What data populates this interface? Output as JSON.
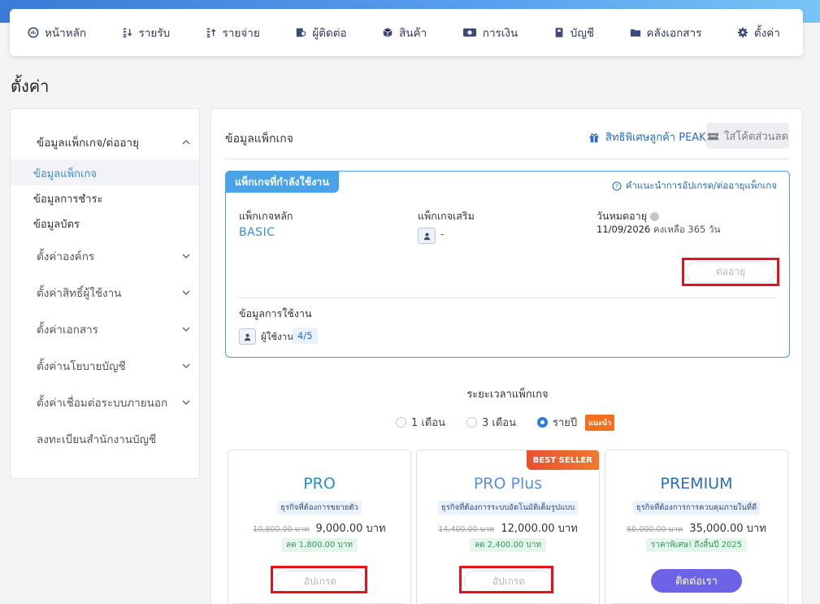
{
  "nav": {
    "items": [
      {
        "label": "หน้าหลัก",
        "icon": "dashboard-icon"
      },
      {
        "label": "รายรับ",
        "icon": "income-icon"
      },
      {
        "label": "รายจ่าย",
        "icon": "expense-icon"
      },
      {
        "label": "ผู้ติดต่อ",
        "icon": "contacts-icon"
      },
      {
        "label": "สินค้า",
        "icon": "box-icon"
      },
      {
        "label": "การเงิน",
        "icon": "money-icon"
      },
      {
        "label": "บัญชี",
        "icon": "ledger-icon"
      },
      {
        "label": "คลังเอกสาร",
        "icon": "folder-icon"
      },
      {
        "label": "ตั้งค่า",
        "icon": "gear-icon"
      }
    ]
  },
  "page": {
    "title": "ตั้งค่า"
  },
  "sidebar": {
    "group_package": "ข้อมูลแพ็กเกจ/ต่ออายุ",
    "sub_items": [
      "ข้อมูลแพ็กเกจ",
      "ข้อมูลการชำระ",
      "ข้อมูลบัตร"
    ],
    "items": [
      "ตั้งค่าองค์กร",
      "ตั้งค่าสิทธิ์ผู้ใช้งาน",
      "ตั้งค่าเอกสาร",
      "ตั้งค่านโยบายบัญชี",
      "ตั้งค่าเชื่อมต่อระบบภายนอก",
      "ลงทะเบียนสำนักงานบัญชี"
    ]
  },
  "main": {
    "title": "ข้อมูลแพ็กเกจ",
    "peak_privilege": "สิทธิพิเศษลูกค้า PEAK",
    "discount_code": "ใส่โค้ดส่วนลด"
  },
  "current": {
    "tag": "แพ็กเกจที่กำลังใช้งาน",
    "guide": "คำแนะนำการอัปเกรด/ต่ออายุแพ็กเกจ",
    "main_label": "แพ็กเกจหลัก",
    "main_value": "BASIC",
    "addon_label": "แพ็กเกจเสริม",
    "addon_value": "-",
    "expire_label": "วันหมดอายุ",
    "expire_date": "11/09/2026",
    "expire_remaining": "คงเหลือ 365 วัน",
    "renew": "ต่ออายุ",
    "usage_title": "ข้อมูลการใช้งาน",
    "users_label": "ผู้ใช้งาน",
    "users_count": "4/5"
  },
  "duration": {
    "title": "ระยะเวลาแพ็กเกจ",
    "options": [
      "1 เดือน",
      "3 เดือน",
      "รายปี"
    ],
    "selected": "รายปี",
    "recommend": "แนะนำ"
  },
  "plans": [
    {
      "name": "PRO",
      "desc": "ธุรกิจที่ต้องการขยายตัว",
      "old_price": "10,800.00 บาท",
      "price": "9,000.00 บาท",
      "discount": "ลด 1,800.00 บาท",
      "button": "อัปเกรด",
      "name_color": "#2a8fc9"
    },
    {
      "name": "PRO Plus",
      "desc": "ธุรกิจที่ต้องการระบบอัตโนมัติเต็มรูปแบบ",
      "old_price": "14,400.00 บาท",
      "price": "12,000.00 บาท",
      "discount": "ลด 2,400.00 บาท",
      "button": "อัปเกรด",
      "badge": "BEST SELLER",
      "name_color": "#5b8fe0"
    },
    {
      "name": "PREMIUM",
      "desc": "ธุรกิจที่ต้องการการควบคุมภายในที่ดี",
      "old_price": "60,000.00 บาท",
      "price": "35,000.00 บาท",
      "discount": "ราคาพิเศษ! ถึงสิ้นปี 2025",
      "button": "ติดต่อเรา",
      "name_color": "#2a6cc0"
    }
  ]
}
